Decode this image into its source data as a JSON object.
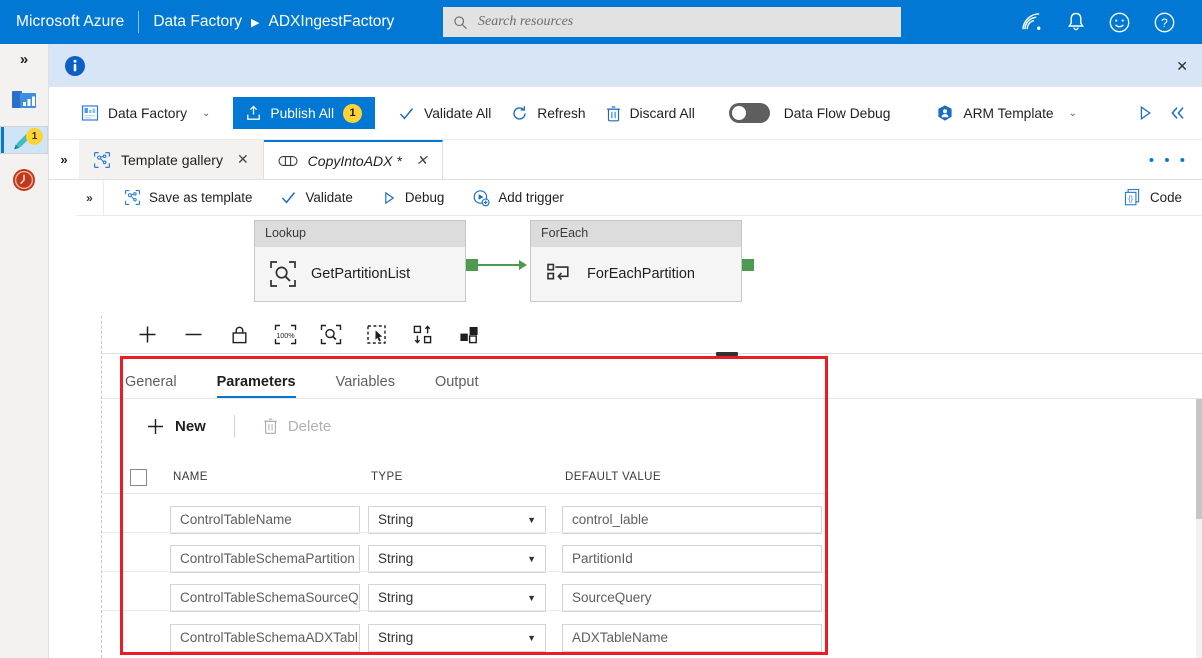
{
  "azure": {
    "brand": "Microsoft Azure",
    "breadcrumb_service": "Data Factory",
    "breadcrumb_arrow": "▶",
    "breadcrumb_resource": "ADXIngestFactory",
    "search_placeholder": "Search resources",
    "icons": [
      "signal-icon",
      "bell-icon",
      "smiley-icon",
      "help-icon"
    ]
  },
  "rail": {
    "expand_chevron": "»",
    "items": [
      {
        "name": "home-icon",
        "label": "Home",
        "selected": false,
        "badge": ""
      },
      {
        "name": "author-pencil-icon",
        "label": "Author",
        "selected": true,
        "badge": "1"
      },
      {
        "name": "monitor-icon",
        "label": "Monitor",
        "selected": false,
        "badge": ""
      }
    ]
  },
  "info_banner": {
    "icon": "info-icon",
    "message": "",
    "close": "✕"
  },
  "toolbar": {
    "factory_label": "Data Factory",
    "factory_chevron": "⌄",
    "publish_label": "Publish All",
    "publish_count": "1",
    "validate_all_label": "Validate All",
    "refresh_label": "Refresh",
    "discard_all_label": "Discard All",
    "data_flow_debug_label": "Data Flow Debug",
    "arm_template_label": "ARM Template",
    "arm_chevron": "⌄"
  },
  "tabstrip": {
    "overflow_chevron": "»",
    "tabs": [
      {
        "label": "Template gallery",
        "icon": "template-gallery-icon",
        "active": false,
        "close": "✕"
      },
      {
        "label": "CopyIntoADX *",
        "icon": "pipeline-icon",
        "active": true,
        "close": "✕"
      }
    ],
    "more_actions": "• • •"
  },
  "pipeline_toolbar": {
    "overflow_chevron": "»",
    "items": [
      {
        "label": "Save as template",
        "icon": "save-as-template-icon"
      },
      {
        "label": "Validate",
        "icon": "checkmark-icon"
      },
      {
        "label": "Debug",
        "icon": "play-icon"
      },
      {
        "label": "Add trigger",
        "icon": "add-trigger-icon"
      }
    ],
    "code_label": "Code",
    "code_icon": "code-icon"
  },
  "canvas": {
    "nodes": [
      {
        "type": "Lookup",
        "name": "GetPartitionList",
        "icon": "lookup-icon"
      },
      {
        "type": "ForEach",
        "name": "ForEachPartition",
        "icon": "foreach-icon"
      }
    ],
    "tools": [
      {
        "name": "zoom-in-icon",
        "glyph": "+"
      },
      {
        "name": "zoom-out-icon",
        "glyph": "−"
      },
      {
        "name": "lock-icon",
        "glyph": ""
      },
      {
        "name": "zoom-100-percent-icon",
        "glyph": "100%"
      },
      {
        "name": "zoom-to-fit-icon",
        "glyph": ""
      },
      {
        "name": "select-mode-icon",
        "glyph": ""
      },
      {
        "name": "auto-align-icon",
        "glyph": ""
      },
      {
        "name": "grouping-icon",
        "glyph": ""
      }
    ]
  },
  "panel": {
    "tabs": [
      {
        "label": "General",
        "active": false
      },
      {
        "label": "Parameters",
        "active": true
      },
      {
        "label": "Variables",
        "active": false
      },
      {
        "label": "Output",
        "active": false
      }
    ],
    "new_label": "New",
    "new_icon": "plus-icon",
    "delete_label": "Delete",
    "delete_icon": "trash-icon",
    "columns": {
      "name": "NAME",
      "type": "TYPE",
      "default_value": "DEFAULT VALUE"
    },
    "rows": [
      {
        "name": "ControlTableName",
        "type": "String",
        "default_value": "control_lable"
      },
      {
        "name": "ControlTableSchemaPartition",
        "type": "String",
        "default_value": "PartitionId"
      },
      {
        "name": "ControlTableSchemaSourceQ",
        "type": "String",
        "default_value": "SourceQuery"
      },
      {
        "name": "ControlTableSchemaADXTabl",
        "type": "String",
        "default_value": "ADXTableName"
      }
    ],
    "type_caret": "▼"
  },
  "colors": {
    "azure_blue": "#0078d4",
    "highlight_red": "#ec1c24",
    "badge_yellow": "#ffd335",
    "node_green": "#4e9a51",
    "info_bg": "#d7e5f7"
  }
}
